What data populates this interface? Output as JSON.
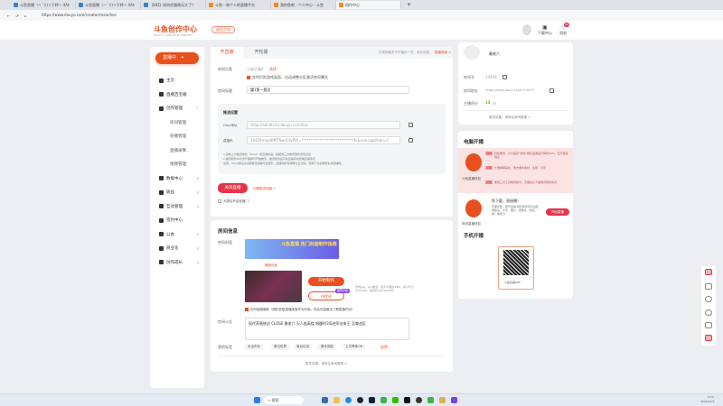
{
  "browser": {
    "tabs": [
      "斗鱼直播（~`つ)ゞ于杯~ 4AI:",
      "斗鱼直播（~`つ)ゞ于杯~ 4AI:",
      "【HD】如何优雅地玩大了？",
      "斗鱼 - 每个人的直播平台",
      "我的鱼吧 - 个人中心 - 斗鱼",
      "创作中心"
    ],
    "url": "https://www.douyu.com/creator/main/live",
    "new_tab": "+"
  },
  "header": {
    "logo": "斗鱼创作中心",
    "logo_sub": "DOUYU CREATOR CENTER",
    "home_button": "返回主站",
    "download": "下载中心",
    "messages": "消息",
    "badge": "99"
  },
  "sidebar": {
    "live_button": "直播中",
    "items": [
      {
        "label": "主页"
      },
      {
        "label": "直播百宝箱"
      },
      {
        "label": "创作管理",
        "chev": "^"
      },
      {
        "label": "房间管理",
        "sub": true
      },
      {
        "label": "轮播管理",
        "sub": true
      },
      {
        "label": "直播录像",
        "sub": true
      },
      {
        "label": "视频管理",
        "sub": true
      },
      {
        "label": "数据中心",
        "chev": "v"
      },
      {
        "label": "收益",
        "chev": "v"
      },
      {
        "label": "互动管理",
        "chev": "v"
      },
      {
        "label": "签约中心"
      },
      {
        "label": "公会",
        "chev": "v"
      },
      {
        "label": "商业化",
        "chev": "v"
      },
      {
        "label": "创作成长",
        "chev": "v"
      }
    ]
  },
  "live": {
    "tabs": [
      "开直播",
      "开轮播"
    ],
    "notice": "分类指南关于开播的一些，请在设置",
    "notice_link": "直播指南 >",
    "category_label": "房间分类",
    "category_value": "小说之猫2",
    "category_select": "选择",
    "auto_category": "实时识别游戏画面，自动调整分区激活房间曝光",
    "title_label": "房间标题",
    "title_value": "魔1第一题灵",
    "push_heading": "推流设置",
    "rtmp_label": "rtmp地址",
    "rtmp_value": "rtmp://sendtc1a.douyu.com/live",
    "code_label": "直播码",
    "code_value": "14429rnay8fMTNwr1dyP8!=*****************************fv&roincognition=t",
    "hints": [
      "1.复制上方推流地址（rtmp）和直播码后，粘贴到三方推流软件对应位置",
      "2.推流软件中点击开播即可开始推流，推流成功后可在直播间内查看直播情况",
      "注意：rtmp地址在切换推流线路时会变化，直播码的有效期为五分钟，到期下次会重新生成直播码。"
    ],
    "close_button": "关闭直播",
    "switch_link": "切换推流线路 >",
    "vertical_label": "大屏后开启轮播"
  },
  "room": {
    "heading": "房间信息",
    "cover_label": "房间封面",
    "banner_text": "斗鱼直播 热门封面制作指南",
    "cover_caption": "横版封面",
    "make_button": "开始制作",
    "upload_button": "AI优化",
    "ai_badge": "推荐升级",
    "cover_hint": "支持jpg、png格式，最大不超过10M，最小尺寸375*205，建议尺寸1125x630",
    "auto_cover": "实时画面截取（随机获取直播画面作为封面，但会尽量截出了解直播内容）",
    "announce_label": "房间公告",
    "announce_value": "现代养殖统治 CLOSE 最老六 天人临高楼 咽醒时3局逆军去来王 至尊战区",
    "tags_label": "我的标签",
    "tags": [
      "永远失利",
      "单位世界",
      "事后访说",
      "基本调查",
      "上次青睐OK"
    ],
    "tags_more": "...",
    "tags_select": "选择",
    "more_settings": "更多设置，请前往房间管理 >"
  },
  "profile": {
    "name": "最老六",
    "room_no_label": "房间号",
    "room_no": "14429",
    "room_url_label": "房间地址",
    "room_url": "https://www.douyu.com/14429",
    "score_label": "主播积分",
    "score": "12",
    "score_unit": "分",
    "more": "更多设置，请前往房间管理 >"
  },
  "pc": {
    "heading": "电脑开播",
    "app1": "斗鱼直播伴侣",
    "features": [
      {
        "tag": "高效",
        "text": "轻松推流，大大提高“游戏”相比画质提升降低20%，显示更多信息"
      },
      {
        "tag": "功能",
        "text": "大量弹幕美化，更方便的素材、主题、可定"
      },
      {
        "tag": "流量",
        "text": "使用三方工具推流模式，无需担心不兼容问题的情况"
      }
    ],
    "app2": "网页直播伴侣",
    "app2_title": "免下载，直接播！",
    "app2_desc": "无需安装，即开直播 网页版伴侣可采集摄像头、文字、图片、摄像头（含直播）等能力",
    "web_button": "网页直播",
    "mobile_heading": "手机开播",
    "qr_caption": "斗鱼直播APP"
  },
  "taskbar": {
    "search": "搜索",
    "time": "9:34",
    "date": "2025/12/9"
  },
  "colors": {
    "accent": "#e8501e",
    "red": "#e8344a"
  }
}
